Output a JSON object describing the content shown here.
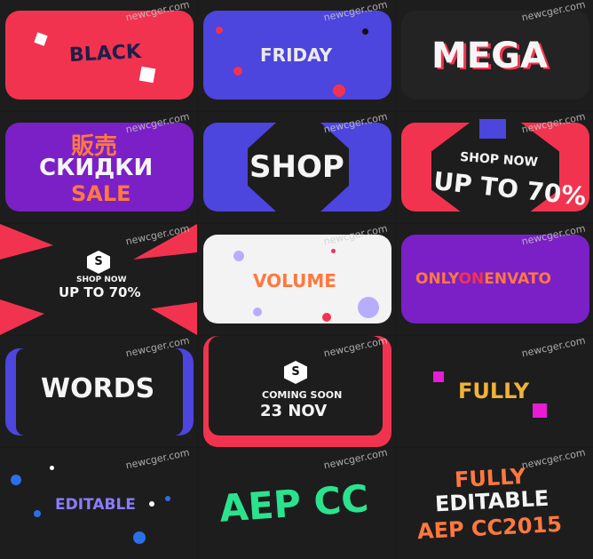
{
  "watermark": "newcger.com",
  "tiles": {
    "t1": "BLACK",
    "t2": "FRIDAY",
    "t3": "MEGA",
    "t4a": "販売",
    "t4b": "СКИДКИ",
    "t4c": "SALE",
    "t5": "SHOP",
    "t6a": "SHOP NOW",
    "t6b": "UP TO 70%",
    "t7a": "SHOP NOW",
    "t7b": "UP TO 70%",
    "t8": "VOLUME",
    "t9a": "ONLY",
    "t9b": "ON",
    "t9c": "ENVATO",
    "t10": "WORDS",
    "t11a": "COMING SOON",
    "t11b": "23 NOV",
    "t12": "FULLY",
    "t13": "EDITABLE",
    "t14": "AEP CC",
    "t15a": "FULLY",
    "t15b": "EDITABLE",
    "t15c": "AEP CC2015"
  },
  "icons": {
    "badge": "S"
  },
  "colors": {
    "red": "#f2334f",
    "blue": "#4c45de",
    "purple": "#7a20c6",
    "orange": "#ff7840",
    "dark": "#1d1d1d"
  }
}
